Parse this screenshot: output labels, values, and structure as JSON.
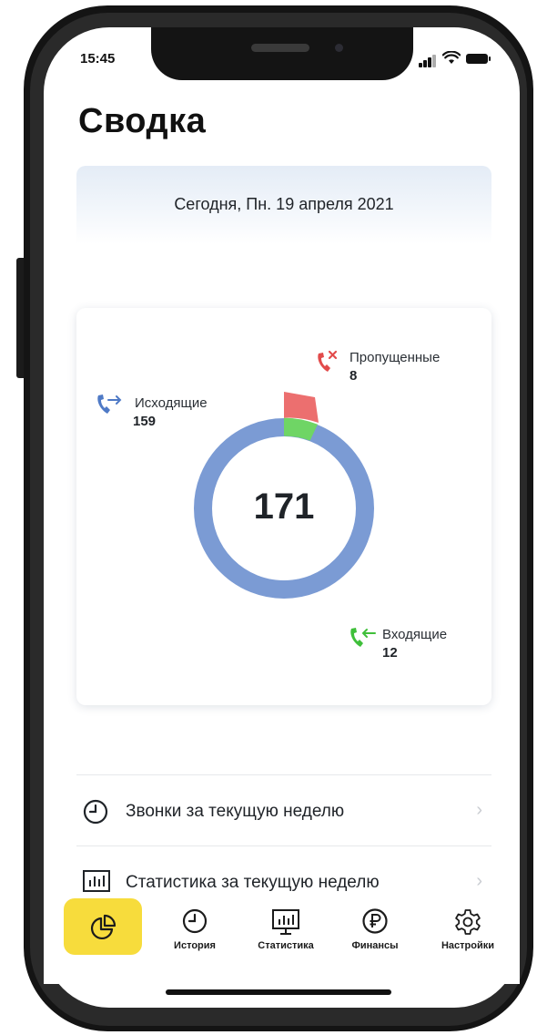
{
  "status_bar": {
    "time": "15:45"
  },
  "title": "Сводка",
  "date_label": "Сегодня, Пн. 19 апреля 2021",
  "summary": {
    "total": "171",
    "outgoing": {
      "label": "Исходящие",
      "value": "159"
    },
    "missed": {
      "label": "Пропущенные",
      "value": "8"
    },
    "incoming": {
      "label": "Входящие",
      "value": "12"
    }
  },
  "colors": {
    "outgoing": "#7b9bd4",
    "missed": "#ec6f6f",
    "incoming": "#6fd565",
    "accent": "#f7dc3c"
  },
  "list": [
    {
      "label": "Звонки за текущую неделю",
      "icon": "clock-icon"
    },
    {
      "label": "Статистика за текущую неделю",
      "icon": "stats-icon"
    }
  ],
  "tabs": [
    {
      "label": "",
      "icon": "pie-chart-icon",
      "active": true
    },
    {
      "label": "История",
      "icon": "clock-icon"
    },
    {
      "label": "Статистика",
      "icon": "monitor-chart-icon"
    },
    {
      "label": "Финансы",
      "icon": "ruble-icon"
    },
    {
      "label": "Настройки",
      "icon": "gear-icon"
    }
  ]
}
